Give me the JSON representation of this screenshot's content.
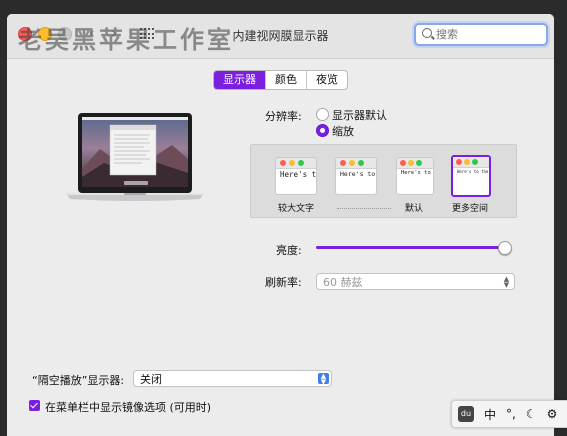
{
  "window": {
    "title": "内建视网膜显示器"
  },
  "search": {
    "value": "",
    "placeholder": "搜索"
  },
  "watermark": "老吴黑苹果工作室",
  "tabs": [
    {
      "label": "显示器",
      "active": true
    },
    {
      "label": "颜色",
      "active": false
    },
    {
      "label": "夜览",
      "active": false
    }
  ],
  "resolution": {
    "label": "分辨率:",
    "options": [
      {
        "label": "显示器默认",
        "selected": false
      },
      {
        "label": "缩放",
        "selected": true
      }
    ]
  },
  "scaled": {
    "sample_text": "Here's to the crazy ones, the misfits, the rebels, the troublemakers, the round pegs in the square holes, the ones who see things differently. They're not fond of rules. And they have",
    "captions": [
      "较大文字",
      "默认",
      "更多空间"
    ],
    "selected_index": 4
  },
  "brightness": {
    "label": "亮度:",
    "value": 0.98
  },
  "refresh": {
    "label": "刷新率:",
    "value": "60 赫兹"
  },
  "airplay": {
    "label": "“隔空播放”显示器:",
    "value": "关闭"
  },
  "mirror_option": {
    "label": "在菜单栏中显示镜像选项 (可用时)",
    "checked": true
  },
  "ime": {
    "badge": "du",
    "lang": "中",
    "punct": "°,",
    "moon": "☾",
    "gear": "⚙"
  },
  "colors": {
    "accent": "#7a1ee0",
    "close": "#fc5f57",
    "minimize": "#fdbc2e"
  }
}
